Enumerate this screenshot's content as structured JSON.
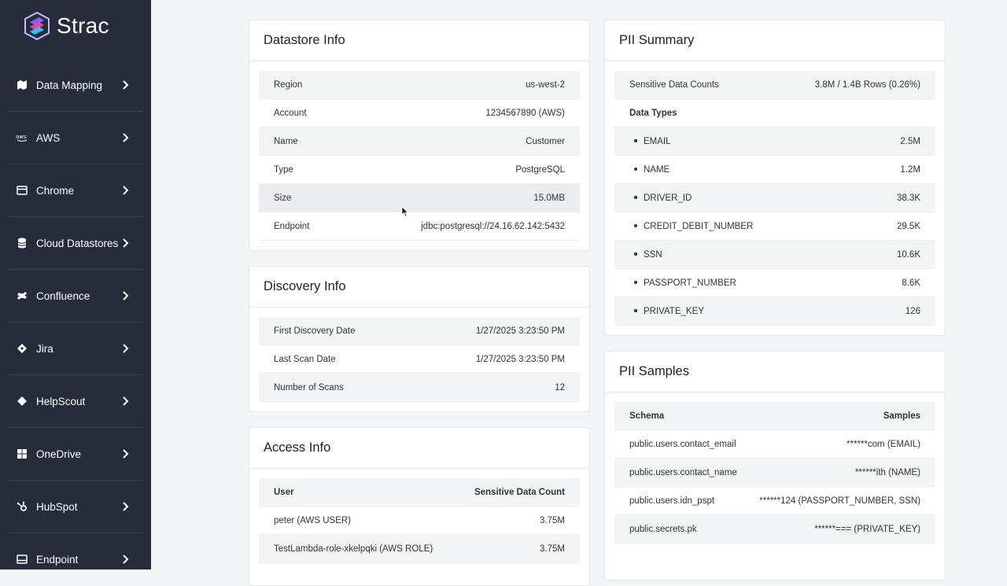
{
  "brand": {
    "name": "Strac"
  },
  "sidebar": {
    "items": [
      {
        "label": "Data Mapping",
        "icon": "map-icon"
      },
      {
        "label": "AWS",
        "icon": "aws-icon"
      },
      {
        "label": "Chrome",
        "icon": "browser-icon"
      },
      {
        "label": "Cloud Datastores",
        "icon": "database-icon"
      },
      {
        "label": "Confluence",
        "icon": "confluence-icon"
      },
      {
        "label": "Jira",
        "icon": "jira-icon"
      },
      {
        "label": "HelpScout",
        "icon": "helpscout-icon"
      },
      {
        "label": "OneDrive",
        "icon": "windows-icon"
      },
      {
        "label": "HubSpot",
        "icon": "hubspot-icon"
      },
      {
        "label": "Endpoint",
        "icon": "endpoint-icon"
      }
    ]
  },
  "datastore_info": {
    "title": "Datastore Info",
    "rows": [
      {
        "label": "Region",
        "value": "us-west-2"
      },
      {
        "label": "Account",
        "value": "1234567890 (AWS)"
      },
      {
        "label": "Name",
        "value": "Customer"
      },
      {
        "label": "Type",
        "value": "PostgreSQL"
      },
      {
        "label": "Size",
        "value": "15.0MB"
      },
      {
        "label": "Endpoint",
        "value": "jdbc:postgresql://24.16.62.142:5432"
      }
    ]
  },
  "discovery_info": {
    "title": "Discovery Info",
    "rows": [
      {
        "label": "First Discovery Date",
        "value": "1/27/2025 3:23:50 PM"
      },
      {
        "label": "Last Scan Date",
        "value": "1/27/2025 3:23:50 PM"
      },
      {
        "label": "Number of Scans",
        "value": "12"
      }
    ]
  },
  "access_info": {
    "title": "Access Info",
    "header": {
      "user": "User",
      "count": "Sensitive Data Count"
    },
    "rows": [
      {
        "label": "peter (AWS USER)",
        "value": "3.75M"
      },
      {
        "label": "TestLambda-role-xkelpqki (AWS ROLE)",
        "value": "3.75M"
      }
    ]
  },
  "pii_summary": {
    "title": "PII Summary",
    "sensitive_label": "Sensitive Data Counts",
    "sensitive_value": "3.8M / 1.4B Rows (0.26%)",
    "data_types_label": "Data Types",
    "types": [
      {
        "label": "EMAIL",
        "value": "2.5M"
      },
      {
        "label": "NAME",
        "value": "1.2M"
      },
      {
        "label": "DRIVER_ID",
        "value": "38.3K"
      },
      {
        "label": "CREDIT_DEBIT_NUMBER",
        "value": "29.5K"
      },
      {
        "label": "SSN",
        "value": "10.6K"
      },
      {
        "label": "PASSPORT_NUMBER",
        "value": "8.6K"
      },
      {
        "label": "PRIVATE_KEY",
        "value": "126"
      }
    ]
  },
  "pii_samples": {
    "title": "PII Samples",
    "header": {
      "schema": "Schema",
      "samples": "Samples"
    },
    "rows": [
      {
        "label": "public.users.contact_email",
        "value": "******com (EMAIL)"
      },
      {
        "label": "public.users.contact_name",
        "value": "******ith (NAME)"
      },
      {
        "label": "public.users.idn_pspt",
        "value": "******124 (PASSPORT_NUMBER, SSN)"
      },
      {
        "label": "public.secrets.pk",
        "value": "******=== (PRIVATE_KEY)"
      }
    ]
  },
  "colors": {
    "sidebar_bg": "#272c3b",
    "page_bg": "#f4f5f7",
    "row_shade": "#f3f4f6",
    "logo_accent": "#8b5cf6"
  }
}
